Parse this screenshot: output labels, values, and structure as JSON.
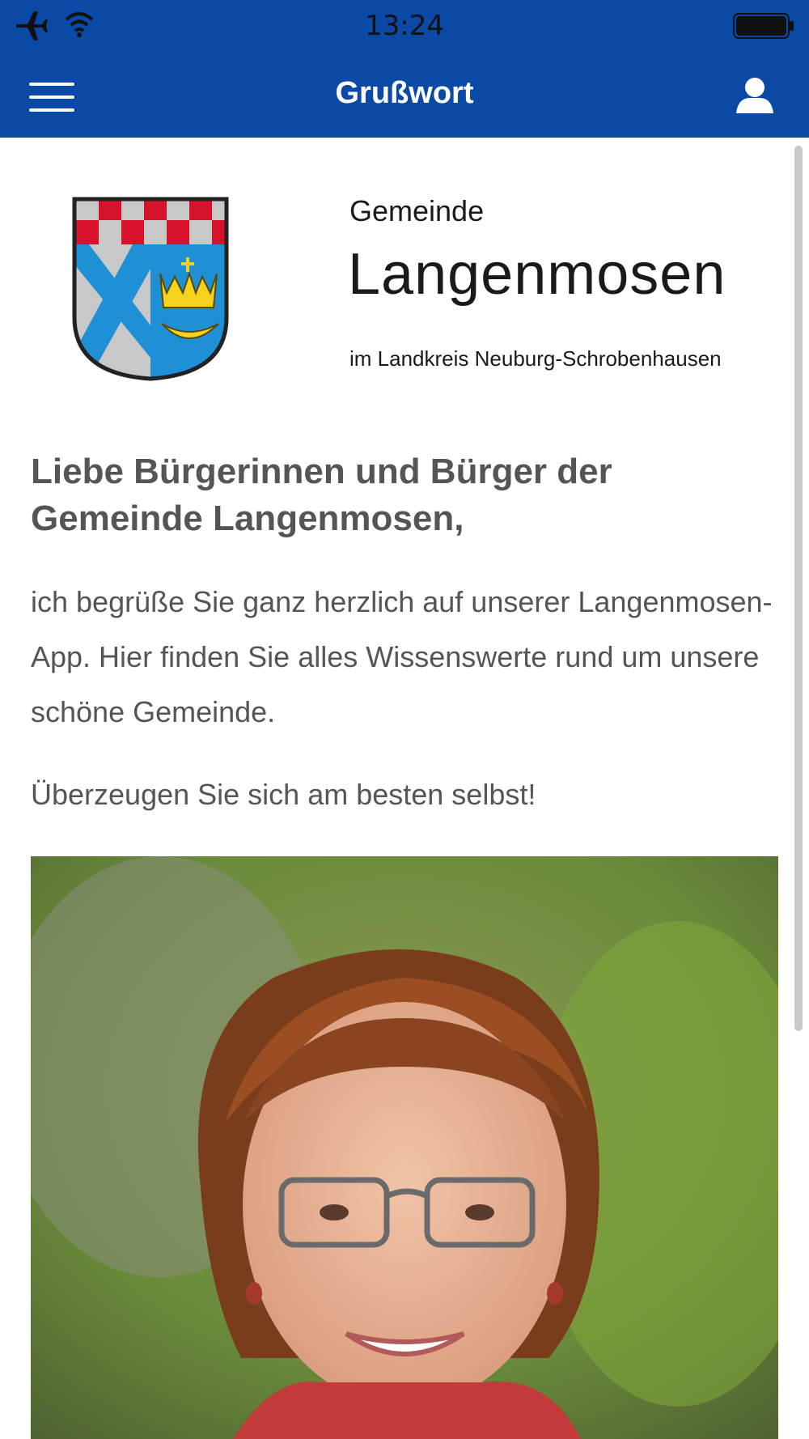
{
  "status_bar": {
    "time": "13:24",
    "airplane_icon": "airplane-icon",
    "wifi_icon": "wifi-icon",
    "battery_icon": "battery-icon"
  },
  "nav": {
    "title": "Grußwort",
    "menu_icon": "hamburger-menu-icon",
    "user_icon": "user-profile-icon"
  },
  "colors": {
    "brand": "#0a4aa6",
    "text": "#555555"
  },
  "logo": {
    "line1": "Gemeinde",
    "line2": "Langenmosen",
    "line3": "im Landkreis Neuburg-Schrobenhausen"
  },
  "content": {
    "headline": "Liebe Bürgerinnen und Bürger der Gemeinde Langenmosen,",
    "paragraph1": "ich begrüße Sie ganz herzlich auf unserer Langenmosen-App. Hier finden Sie alles Wissenswerte rund um unsere schöne Gemeinde.",
    "paragraph2": "Überzeugen Sie sich am besten selbst!"
  }
}
